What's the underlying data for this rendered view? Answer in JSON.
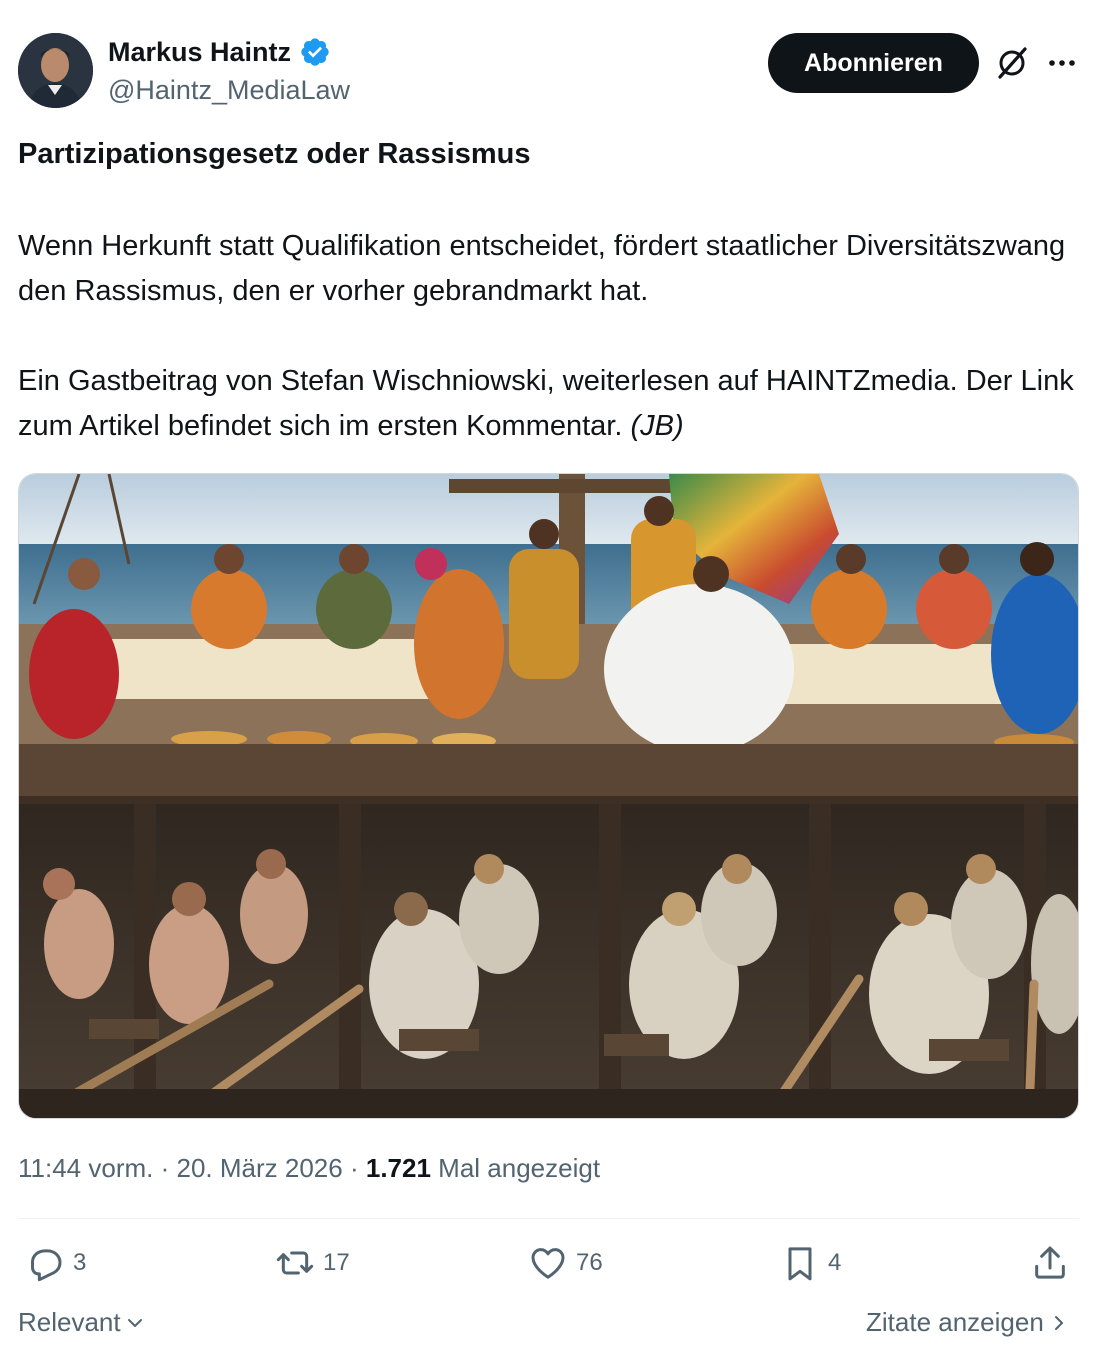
{
  "author": {
    "display_name": "Markus Haintz",
    "handle": "@Haintz_MediaLaw",
    "verified": true
  },
  "header": {
    "follow_label": "Abonnieren",
    "icons": [
      "grok-icon",
      "more-icon"
    ]
  },
  "post": {
    "title": "Partizipationsgesetz oder Rassismus",
    "paragraph1": "Wenn Herkunft statt Qualifikation entscheidet, fördert staatlicher Diversitätszwang den Rassismus, den er vorher gebrandmarkt hat.",
    "paragraph2": "Ein Gastbeitrag von Stefan Wischniowski, weiterlesen auf HAINTZmedia. Der Link zum Artikel befindet sich im ersten Kommentar.",
    "signature": "(JB)"
  },
  "meta": {
    "time": "11:44 vorm.",
    "separator": "·",
    "date": "20. März 2026",
    "views_count": "1.721",
    "views_label": "Mal angezeigt"
  },
  "actions": {
    "replies": "3",
    "reposts": "17",
    "likes": "76",
    "bookmarks": "4"
  },
  "footer": {
    "sort_label": "Relevant",
    "quotes_label": "Zitate anzeigen"
  },
  "colors": {
    "text_primary": "#0f1419",
    "text_secondary": "#536471",
    "verified_blue": "#1d9bf0",
    "divider": "#eff3f4"
  }
}
